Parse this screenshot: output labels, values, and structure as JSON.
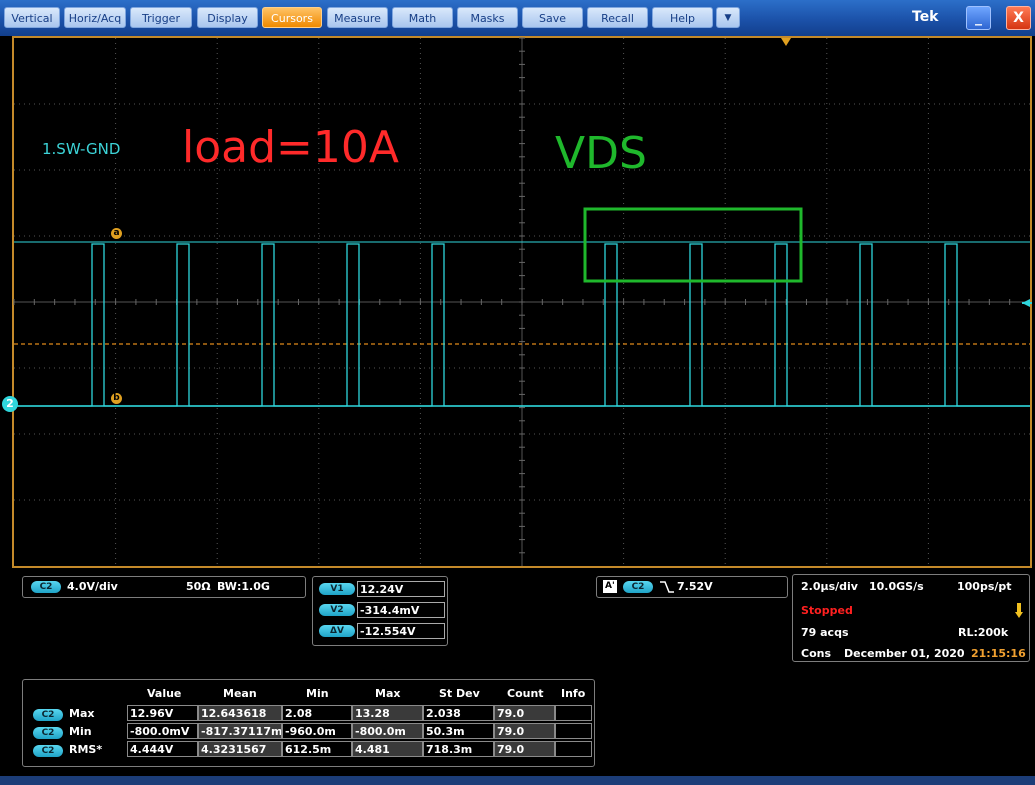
{
  "menu": {
    "items": [
      "Vertical",
      "Horiz/Acq",
      "Trigger",
      "Display",
      "Cursors",
      "Measure",
      "Math",
      "Masks",
      "Save",
      "Recall",
      "Help"
    ],
    "active": "Cursors",
    "dropdown_glyph": "▼",
    "brand": "Tek",
    "minimize_glyph": "_",
    "close_glyph": "X"
  },
  "screen": {
    "channel_label": "1.SW-GND",
    "annotation_load": "load=10A",
    "annotation_vds": "VDS",
    "channel_marker": "2",
    "cursor_a_label": "a",
    "cursor_b_label": "b",
    "colors": {
      "trace": "#2fd6dc",
      "cursor": "#e08a1a",
      "load_text": "#ff2a2a",
      "vds_box": "#1fb82c"
    }
  },
  "channel_info": {
    "badge": "C2",
    "scale": "4.0V/div",
    "impedance": "50Ω",
    "bandwidth_label": "BW",
    "bandwidth": ":1.0G"
  },
  "cursor_readouts": [
    {
      "badge": "V1",
      "value": "12.24V"
    },
    {
      "badge": "V2",
      "value": "-314.4mV"
    },
    {
      "badge": "ΔV",
      "value": "-12.554V"
    }
  ],
  "trigger": {
    "source_badge": "A'",
    "channel_badge": "C2",
    "level": "7.52V",
    "slope_icon": "falling-edge-icon"
  },
  "acquisition": {
    "time_div": "2.0µs/div",
    "sample_rate": "10.0GS/s",
    "resolution": "100ps/pt",
    "status": "Stopped",
    "acqs": "79 acqs",
    "record_length": "RL:200k",
    "mode": "Cons",
    "date": "December 01, 2020",
    "time": "21:15:16"
  },
  "measurements": {
    "headers": [
      "Value",
      "Mean",
      "Min",
      "Max",
      "St Dev",
      "Count",
      "Info"
    ],
    "rows": [
      {
        "badge": "C2",
        "name": "Max",
        "cells": [
          "12.96V",
          "12.643618",
          "2.08",
          "13.28",
          "2.038",
          "79.0",
          ""
        ]
      },
      {
        "badge": "C2",
        "name": "Min",
        "cells": [
          "-800.0mV",
          "-817.37117m",
          "-960.0m",
          "-800.0m",
          "50.3m",
          "79.0",
          ""
        ]
      },
      {
        "badge": "C2",
        "name": "RMS*",
        "cells": [
          "4.444V",
          "4.3231567",
          "612.5m",
          "4.481",
          "718.3m",
          "79.0",
          ""
        ]
      }
    ]
  }
}
